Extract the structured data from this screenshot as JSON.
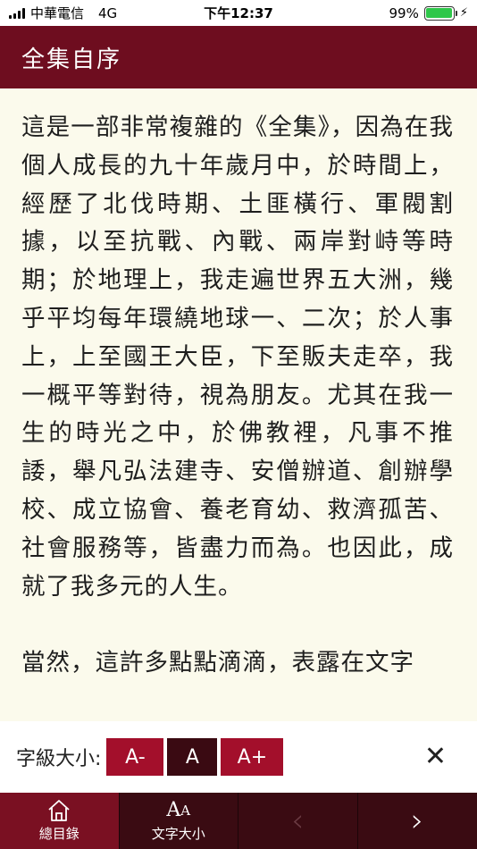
{
  "status_bar": {
    "carrier": "中華電信",
    "network": "4G",
    "time": "下午12:37",
    "battery": "99%",
    "battery_level": 0.99
  },
  "header": {
    "title": "全集自序"
  },
  "content": {
    "paragraphs": [
      "這是一部非常複雜的《全集》，因為在我個人成長的九十年歲月中，於時間上，經歷了北伐時期、土匪橫行、軍閥割據，以至抗戰、內戰、兩岸對峙等時期；於地理上，我走遍世界五大洲，幾乎平均每年環繞地球一、二次；於人事上，上至國王大臣，下至販夫走卒，我一概平等對待，視為朋友。尤其在我一生的時光之中，於佛教裡，凡事不推諉，舉凡弘法建寺、安僧辦道、創辦學校、成立協會、養老育幼、救濟孤苦、社會服務等，皆盡力而為。也因此，成就了我多元的人生。",
      "當然，這許多點點滴滴，表露在文字"
    ]
  },
  "font_bar": {
    "label": "字級大小:",
    "smaller": "A-",
    "normal": "A",
    "larger": "A+",
    "close": "✕"
  },
  "tab_bar": {
    "home_label": "總目錄",
    "font_label": "文字大小",
    "font_icon_big": "A",
    "font_icon_small": "A",
    "prev": "‹",
    "next": "›"
  }
}
